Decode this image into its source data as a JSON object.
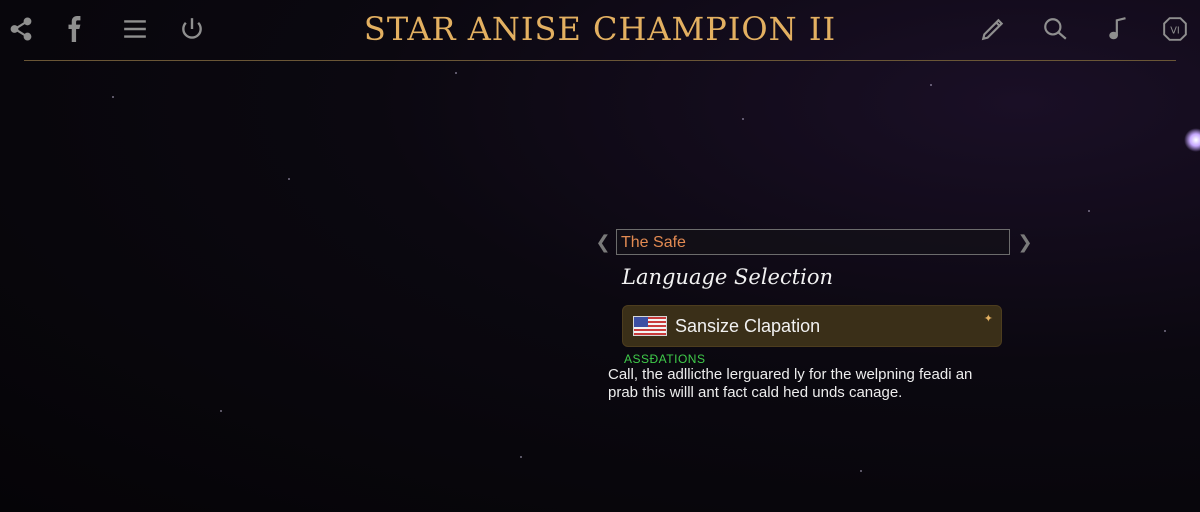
{
  "header": {
    "title": "STAR ANISE CHAMPION II",
    "left_icons": [
      "share-icon",
      "facebook-icon",
      "menu-icon",
      "power-icon"
    ],
    "right_icons": [
      "pencil-icon",
      "search-icon",
      "music-note-icon",
      "shield-badge-icon"
    ],
    "badge_text": "VI",
    "accent_color": "#e3b061"
  },
  "panel": {
    "tab_label": "The Safe",
    "section_title": "Language Selection",
    "selected_language": "Sansize Clapation",
    "flag_icon": "us-flag-icon",
    "hint_label": "ASSĐATIONS",
    "description_line1": "Call, the adllicthe lerguared ly for the welpning feadi an",
    "description_line2": "prab this willl ant fact cald hed unds canage."
  }
}
